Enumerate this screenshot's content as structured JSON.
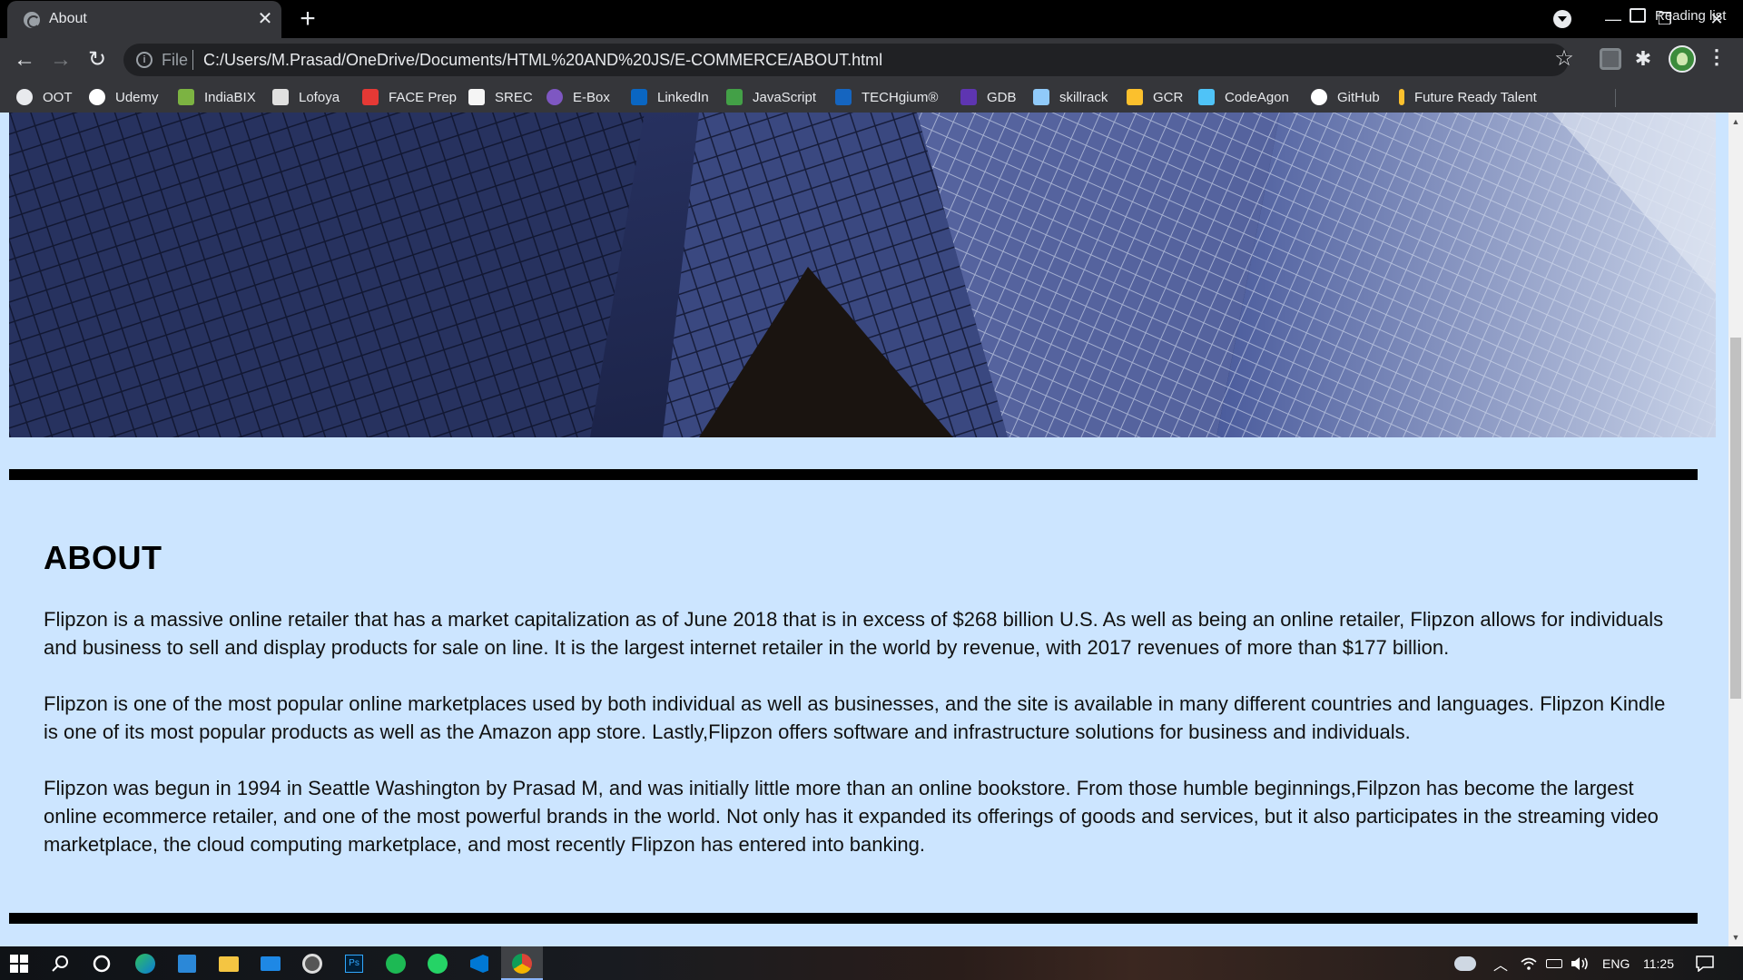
{
  "tab": {
    "title": "About",
    "close": "✕",
    "new_tab": "+"
  },
  "window": {
    "minimize": "—",
    "restore": "❐",
    "close": "✕"
  },
  "toolbar": {
    "back": "←",
    "forward": "→",
    "reload": "↻",
    "protocol_label": "File",
    "url": "C:/Users/M.Prasad/OneDrive/Documents/HTML%20AND%20JS/E-COMMERCE/ABOUT.html",
    "star": "☆",
    "puzzle": "✱",
    "menu": "⋮"
  },
  "bookmarks": [
    {
      "label": "OOT",
      "color": "#e8eaed"
    },
    {
      "label": "Udemy",
      "color": "#ffffff"
    },
    {
      "label": "IndiaBIX",
      "color": "#7cb342"
    },
    {
      "label": "Lofoya",
      "color": "#e0e0e0"
    },
    {
      "label": "FACE Prep",
      "color": "#e53935"
    },
    {
      "label": "SREC",
      "color": "#f5f5f5"
    },
    {
      "label": "E-Box",
      "color": "#7e57c2"
    },
    {
      "label": "LinkedIn",
      "color": "#0a66c2"
    },
    {
      "label": "JavaScript",
      "color": "#43a047"
    },
    {
      "label": "TECHgium®",
      "color": "#1565c0"
    },
    {
      "label": "GDB",
      "color": "#5e35b1"
    },
    {
      "label": "skillrack",
      "color": "#90caf9"
    },
    {
      "label": "GCR",
      "color": "#fbc02d"
    },
    {
      "label": "CodeAgon",
      "color": "#4fc3f7"
    },
    {
      "label": "GitHub",
      "color": "#ffffff"
    },
    {
      "label": "Future Ready Talent",
      "color": "#fbc02d"
    }
  ],
  "reading_list": "Reading list",
  "page": {
    "heading": "ABOUT",
    "paragraphs": [
      "Flipzon is a massive online retailer that has a market capitalization as of June 2018 that is in excess of $268 billion U.S. As well as being an online retailer, Flipzon allows for individuals and business to sell and display products for sale on line. It is the largest internet retailer in the world by revenue, with 2017 revenues of more than $177 billion.",
      "Flipzon is one of the most popular online marketplaces used by both individual as well as businesses, and the site is available in many different countries and languages. Flipzon Kindle is one of its most popular products as well as the Amazon app store. Lastly,Flipzon offers software and infrastructure solutions for business and individuals.",
      "Flipzon was begun in 1994 in Seattle Washington by Prasad M, and was initially little more than an online bookstore. From those humble beginnings,Filpzon has become the largest online ecommerce retailer, and one of the most powerful brands in the world. Not only has it expanded its offerings of goods and services, but it also participates in the streaming video marketplace, the cloud computing marketplace, and most recently Flipzon has entered into banking."
    ]
  },
  "taskbar": {
    "language": "ENG",
    "time": "11:25"
  },
  "colors": {
    "page_background": "#cce5ff",
    "divider": "#000000",
    "chrome_dark": "#35363a"
  }
}
